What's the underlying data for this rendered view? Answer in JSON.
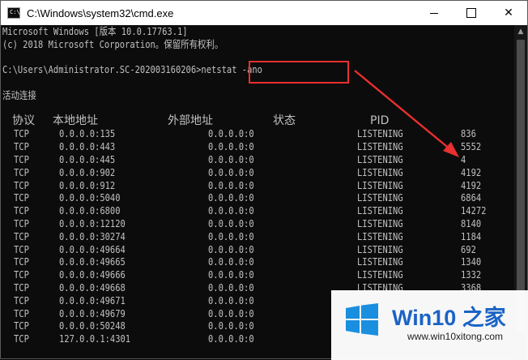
{
  "window": {
    "title": "C:\\Windows\\system32\\cmd.exe",
    "icon": "cmd-icon",
    "icon_label": "C:\\."
  },
  "console": {
    "header1": "Microsoft Windows [版本 10.0.17763.1]",
    "header2": "(c) 2018 Microsoft Corporation。保留所有权利。",
    "prompt": "C:\\Users\\Administrator.SC-202003160206>",
    "command": "netstat -ano",
    "section_title": "活动连接",
    "columns": [
      "协议",
      "本地地址",
      "外部地址",
      "状态",
      "PID"
    ],
    "rows": [
      [
        "TCP",
        "0.0.0.0:135",
        "0.0.0.0:0",
        "LISTENING",
        "836"
      ],
      [
        "TCP",
        "0.0.0.0:443",
        "0.0.0.0:0",
        "LISTENING",
        "5552"
      ],
      [
        "TCP",
        "0.0.0.0:445",
        "0.0.0.0:0",
        "LISTENING",
        "4"
      ],
      [
        "TCP",
        "0.0.0.0:902",
        "0.0.0.0:0",
        "LISTENING",
        "4192"
      ],
      [
        "TCP",
        "0.0.0.0:912",
        "0.0.0.0:0",
        "LISTENING",
        "4192"
      ],
      [
        "TCP",
        "0.0.0.0:5040",
        "0.0.0.0:0",
        "LISTENING",
        "6864"
      ],
      [
        "TCP",
        "0.0.0.0:6800",
        "0.0.0.0:0",
        "LISTENING",
        "14272"
      ],
      [
        "TCP",
        "0.0.0.0:12120",
        "0.0.0.0:0",
        "LISTENING",
        "8140"
      ],
      [
        "TCP",
        "0.0.0.0:30274",
        "0.0.0.0:0",
        "LISTENING",
        "1184"
      ],
      [
        "TCP",
        "0.0.0.0:49664",
        "0.0.0.0:0",
        "LISTENING",
        "692"
      ],
      [
        "TCP",
        "0.0.0.0:49665",
        "0.0.0.0:0",
        "LISTENING",
        "1340"
      ],
      [
        "TCP",
        "0.0.0.0:49666",
        "0.0.0.0:0",
        "LISTENING",
        "1332"
      ],
      [
        "TCP",
        "0.0.0.0:49668",
        "0.0.0.0:0",
        "LISTENING",
        "3368"
      ],
      [
        "TCP",
        "0.0.0.0:49671",
        "0.0.0.0:0",
        "",
        ""
      ],
      [
        "TCP",
        "0.0.0.0:49679",
        "0.0.0.0:0",
        "",
        ""
      ],
      [
        "TCP",
        "0.0.0.0:50248",
        "0.0.0.0:0",
        "",
        ""
      ],
      [
        "TCP",
        "127.0.0.1:4301",
        "0.0.0.0:0",
        "",
        ""
      ]
    ]
  },
  "watermark": {
    "title": "Win10 之家",
    "url": "www.win10xitong.com"
  },
  "colors": {
    "console_bg": "#0c0c0c",
    "console_text": "#c0c0c0",
    "highlight": "#e8302e",
    "brand_blue": "#1a63c5"
  }
}
